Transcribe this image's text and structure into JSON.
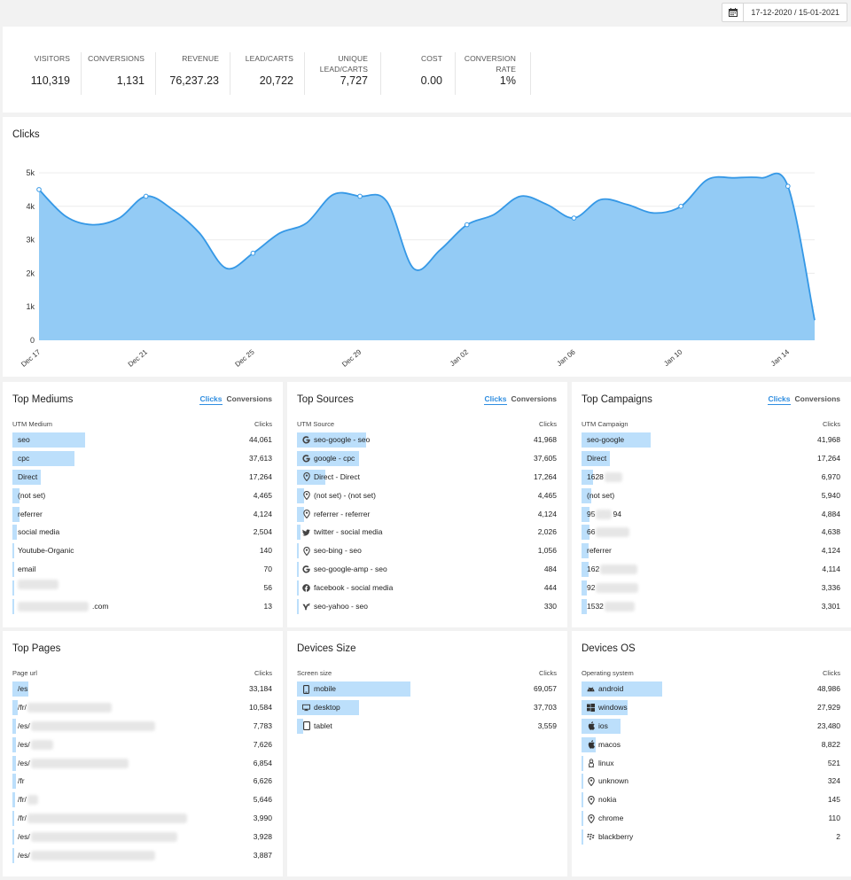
{
  "date_range": "17-12-2020 / 15-01-2021",
  "kpis": [
    {
      "label": "VISITORS",
      "value": "110,319"
    },
    {
      "label": "CONVERSIONS",
      "value": "1,131"
    },
    {
      "label": "REVENUE",
      "value": "76,237.23"
    },
    {
      "label": "LEAD/CARTS",
      "value": "20,722"
    },
    {
      "label": "UNIQUE LEAD/CARTS",
      "value": "7,727"
    },
    {
      "label": "COST",
      "value": "0.00"
    },
    {
      "label": "CONVERSION RATE",
      "value": "1%"
    }
  ],
  "clicks_chart": {
    "title": "Clicks",
    "chart_data": {
      "type": "area",
      "ytick_labels": [
        "0",
        "1k",
        "2k",
        "3k",
        "4k",
        "5k"
      ],
      "ylim": [
        0,
        5000
      ],
      "xtick_labels": [
        "Dec 17",
        "Dec 21",
        "Dec 25",
        "Dec 29",
        "Jan 02",
        "Jan 06",
        "Jan 10",
        "Jan 14"
      ],
      "x": [
        "Dec 17",
        "Dec 18",
        "Dec 19",
        "Dec 20",
        "Dec 21",
        "Dec 22",
        "Dec 23",
        "Dec 24",
        "Dec 25",
        "Dec 26",
        "Dec 27",
        "Dec 28",
        "Dec 29",
        "Dec 30",
        "Dec 31",
        "Jan 01",
        "Jan 02",
        "Jan 03",
        "Jan 04",
        "Jan 05",
        "Jan 06",
        "Jan 07",
        "Jan 08",
        "Jan 09",
        "Jan 10",
        "Jan 11",
        "Jan 12",
        "Jan 13",
        "Jan 14",
        "Jan 15"
      ],
      "values": [
        4500,
        3700,
        3450,
        3650,
        4300,
        3900,
        3200,
        2150,
        2600,
        3200,
        3500,
        4350,
        4300,
        4150,
        2150,
        2700,
        3450,
        3750,
        4300,
        4050,
        3650,
        4200,
        4050,
        3800,
        4000,
        4800,
        4850,
        4850,
        4600,
        600
      ],
      "color": "#93cbf5",
      "line_color": "#3598e6",
      "grid": true
    }
  },
  "toggle": {
    "clicks": "Clicks",
    "conversions": "Conversions"
  },
  "col_clicks": "Clicks",
  "top_mediums": {
    "title": "Top Mediums",
    "column": "UTM Medium",
    "rows": [
      {
        "label": "seo",
        "value": "44,061",
        "n": 44061
      },
      {
        "label": "cpc",
        "value": "37,613",
        "n": 37613
      },
      {
        "label": "Direct",
        "value": "17,264",
        "n": 17264
      },
      {
        "label": "(not set)",
        "value": "4,465",
        "n": 4465
      },
      {
        "label": "referrer",
        "value": "4,124",
        "n": 4124
      },
      {
        "label": "social media",
        "value": "2,504",
        "n": 2504
      },
      {
        "label": "Youtube-Organic",
        "value": "140",
        "n": 140
      },
      {
        "label": "email",
        "value": "70",
        "n": 70
      },
      {
        "label": "",
        "value": "56",
        "n": 56
      },
      {
        "label": ".com",
        "value": "13",
        "n": 13
      }
    ]
  },
  "top_sources": {
    "title": "Top Sources",
    "column": "UTM Source",
    "rows": [
      {
        "label": "seo-google - seo",
        "value": "41,968",
        "n": 41968,
        "icon": "google-icon"
      },
      {
        "label": "google - cpc",
        "value": "37,605",
        "n": 37605,
        "icon": "google-icon"
      },
      {
        "label": "Direct - Direct",
        "value": "17,264",
        "n": 17264,
        "icon": "location-pin-icon"
      },
      {
        "label": "(not set) - (not set)",
        "value": "4,465",
        "n": 4465,
        "icon": "location-pin-icon"
      },
      {
        "label": "referrer - referrer",
        "value": "4,124",
        "n": 4124,
        "icon": "location-pin-icon"
      },
      {
        "label": "twitter - social media",
        "value": "2,026",
        "n": 2026,
        "icon": "twitter-icon"
      },
      {
        "label": "seo-bing - seo",
        "value": "1,056",
        "n": 1056,
        "icon": "location-pin-icon"
      },
      {
        "label": "seo-google-amp - seo",
        "value": "484",
        "n": 484,
        "icon": "google-icon"
      },
      {
        "label": "facebook - social media",
        "value": "444",
        "n": 444,
        "icon": "facebook-icon"
      },
      {
        "label": "seo-yahoo - seo",
        "value": "330",
        "n": 330,
        "icon": "yahoo-icon"
      }
    ]
  },
  "top_campaigns": {
    "title": "Top Campaigns",
    "column": "UTM Campaign",
    "rows": [
      {
        "label": "seo-google",
        "value": "41,968",
        "n": 41968
      },
      {
        "label": "Direct",
        "value": "17,264",
        "n": 17264
      },
      {
        "label": "1628",
        "value": "6,970",
        "n": 6970
      },
      {
        "label": "(not set)",
        "value": "5,940",
        "n": 5940
      },
      {
        "label": "95",
        "value": "4,884",
        "n": 4884,
        "suffix": "94"
      },
      {
        "label": "66",
        "value": "4,638",
        "n": 4638
      },
      {
        "label": "referrer",
        "value": "4,124",
        "n": 4124
      },
      {
        "label": "162",
        "value": "4,114",
        "n": 4114
      },
      {
        "label": "92",
        "value": "3,336",
        "n": 3336
      },
      {
        "label": "1532",
        "value": "3,301",
        "n": 3301
      }
    ]
  },
  "top_pages": {
    "title": "Top Pages",
    "column": "Page url",
    "rows": [
      {
        "label": "/es",
        "value": "33,184",
        "n": 33184
      },
      {
        "label": "/fr/",
        "value": "10,584",
        "n": 10584
      },
      {
        "label": "/es/",
        "value": "7,783",
        "n": 7783
      },
      {
        "label": "/es/",
        "value": "7,626",
        "n": 7626
      },
      {
        "label": "/es/",
        "value": "6,854",
        "n": 6854
      },
      {
        "label": "/fr",
        "value": "6,626",
        "n": 6626
      },
      {
        "label": "/fr/",
        "value": "5,646",
        "n": 5646
      },
      {
        "label": "/fr/",
        "value": "3,990",
        "n": 3990
      },
      {
        "label": "/es/",
        "value": "3,928",
        "n": 3928
      },
      {
        "label": "/es/",
        "value": "3,887",
        "n": 3887
      }
    ]
  },
  "devices_size": {
    "title": "Devices Size",
    "column": "Screen size",
    "rows": [
      {
        "label": "mobile",
        "value": "69,057",
        "n": 69057,
        "icon": "mobile-icon"
      },
      {
        "label": "desktop",
        "value": "37,703",
        "n": 37703,
        "icon": "desktop-icon"
      },
      {
        "label": "tablet",
        "value": "3,559",
        "n": 3559,
        "icon": "tablet-icon"
      }
    ]
  },
  "devices_os": {
    "title": "Devices OS",
    "column": "Operating system",
    "rows": [
      {
        "label": "android",
        "value": "48,986",
        "n": 48986,
        "icon": "android-icon"
      },
      {
        "label": "windows",
        "value": "27,929",
        "n": 27929,
        "icon": "windows-icon"
      },
      {
        "label": "ios",
        "value": "23,480",
        "n": 23480,
        "icon": "apple-icon"
      },
      {
        "label": "macos",
        "value": "8,822",
        "n": 8822,
        "icon": "apple-icon"
      },
      {
        "label": "linux",
        "value": "521",
        "n": 521,
        "icon": "linux-icon"
      },
      {
        "label": "unknown",
        "value": "324",
        "n": 324,
        "icon": "location-pin-icon"
      },
      {
        "label": "nokia",
        "value": "145",
        "n": 145,
        "icon": "location-pin-icon"
      },
      {
        "label": "chrome",
        "value": "110",
        "n": 110,
        "icon": "location-pin-icon"
      },
      {
        "label": "blackberry",
        "value": "2",
        "n": 2,
        "icon": "blackberry-icon"
      }
    ]
  }
}
